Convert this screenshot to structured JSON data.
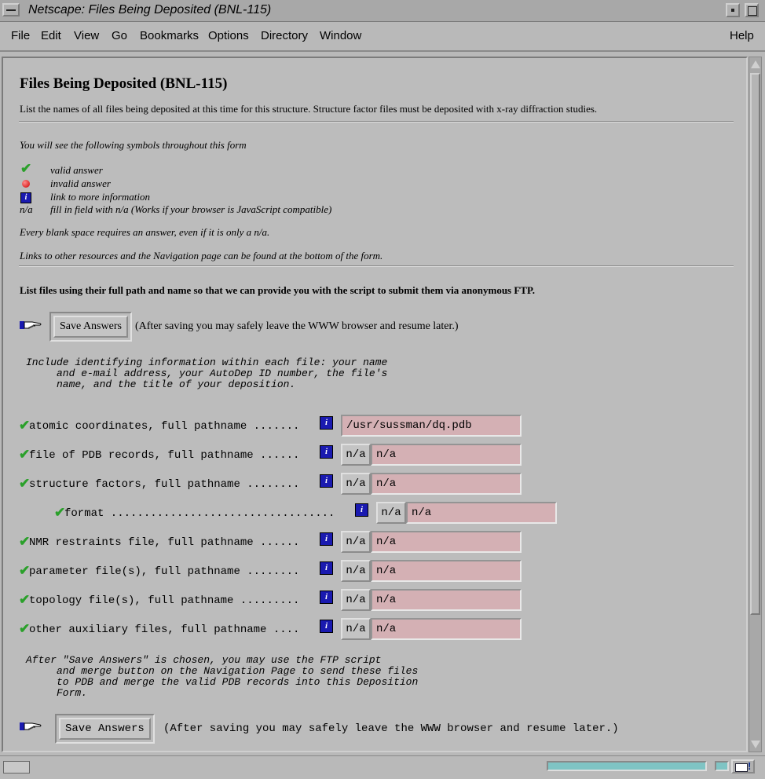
{
  "window": {
    "title": "Netscape: Files Being Deposited (BNL-115)"
  },
  "menu": [
    "File",
    "Edit",
    "View",
    "Go",
    "Bookmarks",
    "Options",
    "Directory",
    "Window",
    "Help"
  ],
  "page": {
    "heading": "Files Being Deposited (BNL-115)",
    "intro": "List the names of all files being deposited at this time for this structure. Structure factor files must be deposited with x-ray diffraction studies.",
    "symbols_intro": "You will see the following symbols throughout this form",
    "legend": [
      {
        "icon": "check-icon",
        "text": "valid answer"
      },
      {
        "icon": "red-ball-icon",
        "text": "invalid answer"
      },
      {
        "icon": "info-icon",
        "text": "link to more information"
      },
      {
        "icon": "n/a",
        "text": "fill in field with n/a (Works if your browser is JavaScript compatible)"
      }
    ],
    "blank_note": "Every blank space requires an answer, even if it is only a n/a.",
    "links_note": "Links to other resources and the Navigation page can be found at the bottom of the form.",
    "list_instruction": "List files using their full path and name so that we can provide you with the script to submit them via anonymous FTP.",
    "save_button": "Save Answers",
    "save_note": "(After saving you may safely leave the WWW browser and resume later.)",
    "include_note_lines": [
      "Include identifying information within each file: your name",
      "     and e-mail address, your AutoDep ID number, the file's",
      "     name, and the title of your deposition."
    ],
    "fields": [
      {
        "label": "atomic coordinates, full pathname .......",
        "value": "/usr/sussman/dq.pdb",
        "na": ""
      },
      {
        "label": "file of PDB records, full pathname ......",
        "value": "n/a",
        "na": "n/a"
      },
      {
        "label": "structure factors, full pathname ........",
        "value": "n/a",
        "na": "n/a"
      },
      {
        "label": "format ..................................",
        "value": "n/a",
        "na": "n/a"
      },
      {
        "label": "NMR restraints file, full pathname ......",
        "value": "n/a",
        "na": "n/a"
      },
      {
        "label": "parameter file(s), full pathname ........",
        "value": "n/a",
        "na": "n/a"
      },
      {
        "label": "topology file(s), full pathname .........",
        "value": "n/a",
        "na": "n/a"
      },
      {
        "label": "other auxiliary files, full pathname ....",
        "value": "n/a",
        "na": "n/a"
      }
    ],
    "after_note_lines": [
      "After \"Save Answers\" is chosen, you may use the FTP script",
      "     and merge button on the Navigation Page to send these files",
      "     to PDB and merge the valid PDB records into this Deposition",
      "     Form."
    ]
  },
  "colors": {
    "input_bg": "#d4b0b4",
    "check": "#2aa02a",
    "info": "#1a1ab0",
    "progress": "#7fc4c4"
  }
}
